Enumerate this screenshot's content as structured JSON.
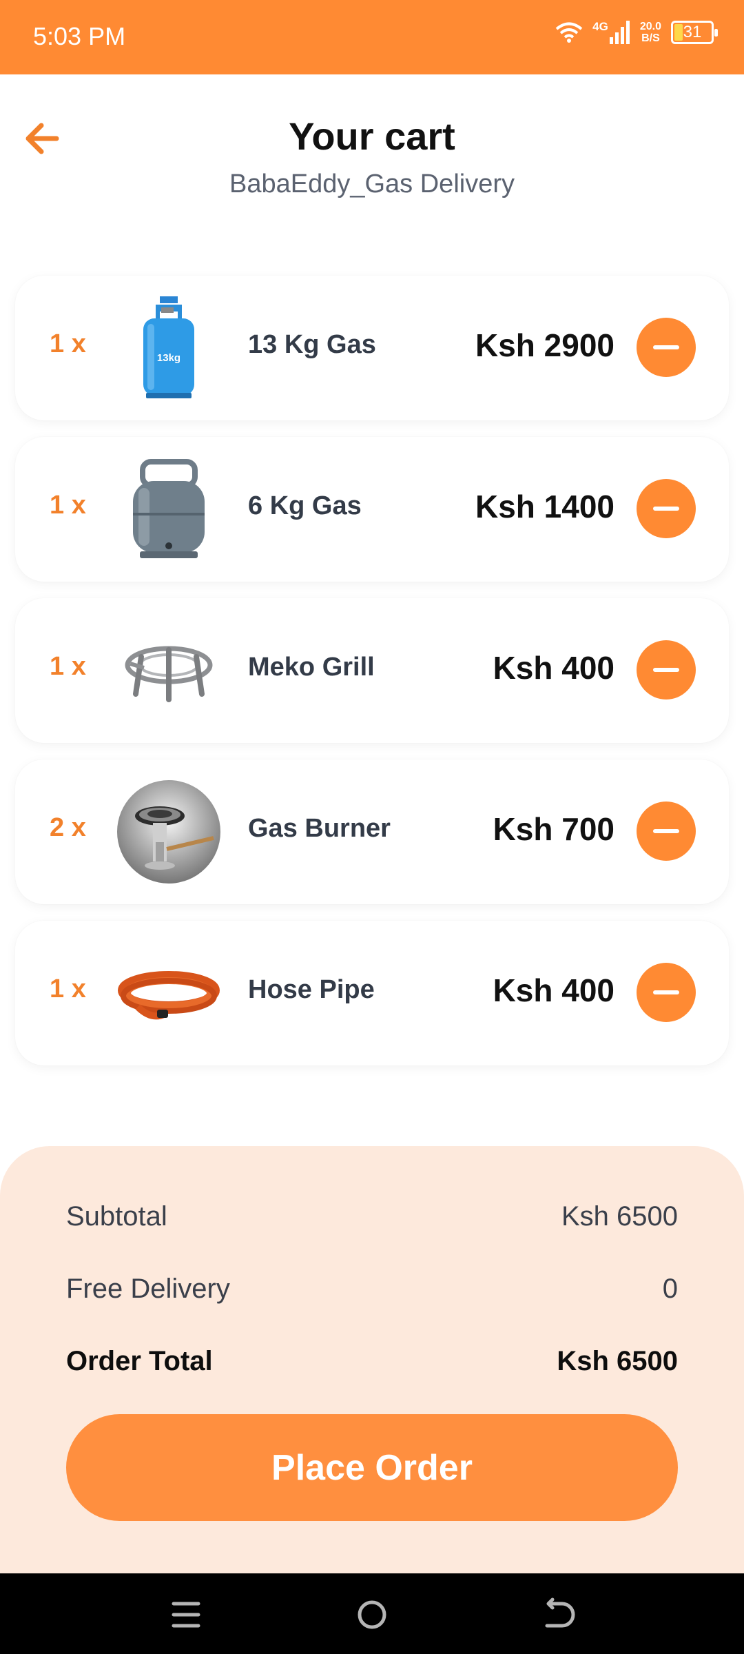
{
  "status_bar": {
    "time": "5:03 PM",
    "network": "4G",
    "speed_top": "20.0",
    "speed_bottom": "B/S",
    "battery": "31"
  },
  "header": {
    "title": "Your cart",
    "subtitle": "BabaEddy_Gas Delivery"
  },
  "cart": {
    "items": [
      {
        "qty": "1 x",
        "name": "13 Kg Gas",
        "price": "Ksh 2900",
        "icon": "gas-cylinder-13kg",
        "badge": "13kg"
      },
      {
        "qty": "1 x",
        "name": "6 Kg Gas",
        "price": "Ksh 1400",
        "icon": "gas-cylinder-6kg"
      },
      {
        "qty": "1 x",
        "name": "Meko Grill",
        "price": "Ksh 400",
        "icon": "meko-grill"
      },
      {
        "qty": "2 x",
        "name": "Gas Burner",
        "price": "Ksh 700",
        "icon": "gas-burner"
      },
      {
        "qty": "1 x",
        "name": "Hose Pipe",
        "price": "Ksh 400",
        "icon": "hose-pipe"
      }
    ]
  },
  "summary": {
    "subtotal_label": "Subtotal",
    "subtotal_value": "Ksh 6500",
    "delivery_label": "Free Delivery",
    "delivery_value": "0",
    "total_label": "Order Total",
    "total_value": "Ksh 6500",
    "place_order_label": "Place Order"
  },
  "colors": {
    "accent": "#FF8A33",
    "summary_bg": "#FDE9DC",
    "qty_text": "#F2812B"
  }
}
